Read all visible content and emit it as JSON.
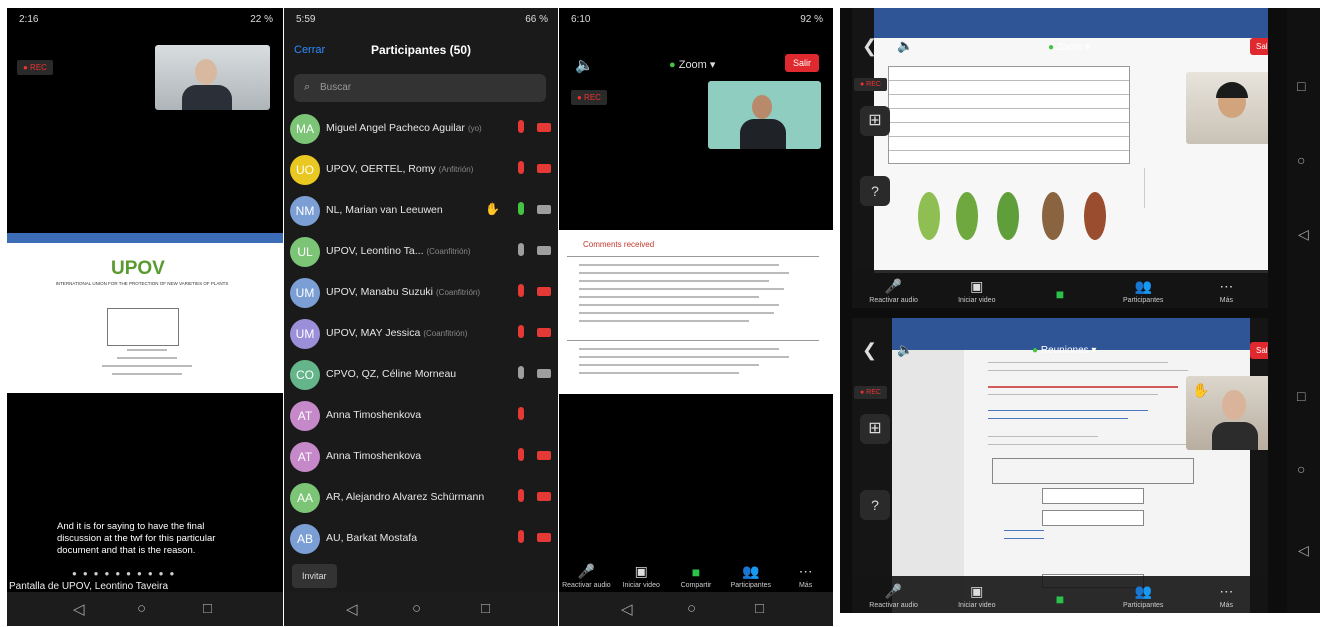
{
  "panel1": {
    "time": "2:16",
    "status_right": "22 %",
    "rec_label": "● REC",
    "doc_logo": "UPOV",
    "doc_subtitle": "INTERNATIONAL UNION FOR THE PROTECTION OF NEW VARIETIES OF PLANTS",
    "caption": "And it is for saying to have the final discussion at the twf for this particular document and that is the reason.",
    "share_label": "Pantalla de UPOV, Leontino Taveira"
  },
  "panel2": {
    "time": "5:59",
    "status_right": "66 %",
    "cancel_label": "Cerrar",
    "header_title": "Participantes (50)",
    "search_placeholder": "Buscar",
    "invite_label": "Invitar",
    "participants": [
      {
        "initials": "MA",
        "name": "Miguel Angel Pacheco Aguilar",
        "role": "(yo)",
        "color": "#7cc576",
        "mic": "red",
        "cam": "red",
        "hand": false
      },
      {
        "initials": "UO",
        "name": "UPOV, OERTEL, Romy",
        "role": "(Anfitrión)",
        "color": "#e8c821",
        "mic": "red",
        "cam": "red",
        "hand": false
      },
      {
        "initials": "NM",
        "name": "NL, Marian van Leeuwen",
        "role": "",
        "color": "#7b9fd4",
        "mic": "green",
        "cam": "grey",
        "hand": true
      },
      {
        "initials": "UL",
        "name": "UPOV, Leontino Ta...",
        "role": "(Coanfitrión)",
        "color": "#7cc576",
        "mic": "grey",
        "cam": "grey",
        "hand": false
      },
      {
        "initials": "UM",
        "name": "UPOV, Manabu Suzuki",
        "role": "(Coanfitrión)",
        "color": "#7b9fd4",
        "mic": "red",
        "cam": "red",
        "hand": false
      },
      {
        "initials": "UM",
        "name": "UPOV, MAY Jessica",
        "role": "(Coanfitrión)",
        "color": "#9a8fd8",
        "mic": "red",
        "cam": "red",
        "hand": false
      },
      {
        "initials": "CO",
        "name": "CPVO, QZ, Céline Morneau",
        "role": "",
        "color": "#65b58a",
        "mic": "grey",
        "cam": "grey",
        "hand": false
      },
      {
        "initials": "AT",
        "name": "Anna Timoshenkova",
        "role": "",
        "color": "#c589c9",
        "mic": "red",
        "cam": "none",
        "hand": false
      },
      {
        "initials": "AT",
        "name": "Anna Timoshenkova",
        "role": "",
        "color": "#c589c9",
        "mic": "red",
        "cam": "red",
        "hand": false
      },
      {
        "initials": "AA",
        "name": "AR, Alejandro Alvarez Schürmann",
        "role": "",
        "color": "#7cc576",
        "mic": "red",
        "cam": "red",
        "hand": false
      },
      {
        "initials": "AB",
        "name": "AU, Barkat Mostafa",
        "role": "",
        "color": "#7b9fd4",
        "mic": "red",
        "cam": "red",
        "hand": false
      }
    ]
  },
  "panel3": {
    "time": "6:10",
    "status_right": "92 %",
    "zoom_label": "Zoom",
    "leave_label": "Salir",
    "rec_label": "● REC",
    "doc_heading": "Comments received",
    "toolbar": [
      {
        "icon": "mic",
        "label": "Reactivar audio"
      },
      {
        "icon": "video",
        "label": "Iniciar video"
      },
      {
        "icon": "share",
        "label": "Compartir"
      },
      {
        "icon": "people",
        "label": "Participantes"
      },
      {
        "icon": "more",
        "label": "Más"
      }
    ]
  },
  "panel4": {
    "zoom_label": "Zoom",
    "leave_label": "Salir",
    "rec_label": "● REC",
    "toolbar": [
      {
        "icon": "mic",
        "label": "Reactivar audio"
      },
      {
        "icon": "video",
        "label": "Iniciar video"
      },
      {
        "icon": "share",
        "label": ""
      },
      {
        "icon": "people",
        "label": "Participantes"
      },
      {
        "icon": "more",
        "label": "Más"
      }
    ]
  },
  "panel5": {
    "zoom_label": "Reuniones",
    "leave_label": "Salir",
    "rec_label": "● REC",
    "toolbar": [
      {
        "icon": "mic",
        "label": "Reactivar audio"
      },
      {
        "icon": "video",
        "label": "Iniciar video"
      },
      {
        "icon": "share",
        "label": ""
      },
      {
        "icon": "people",
        "label": "Participantes"
      },
      {
        "icon": "more",
        "label": "Más"
      }
    ]
  },
  "colors": {
    "mic_red": "#e53935",
    "mic_green": "#43c443",
    "mic_grey": "#9e9e9e",
    "leave_red": "#e0292f",
    "zoom_blue": "#2d8cff"
  }
}
